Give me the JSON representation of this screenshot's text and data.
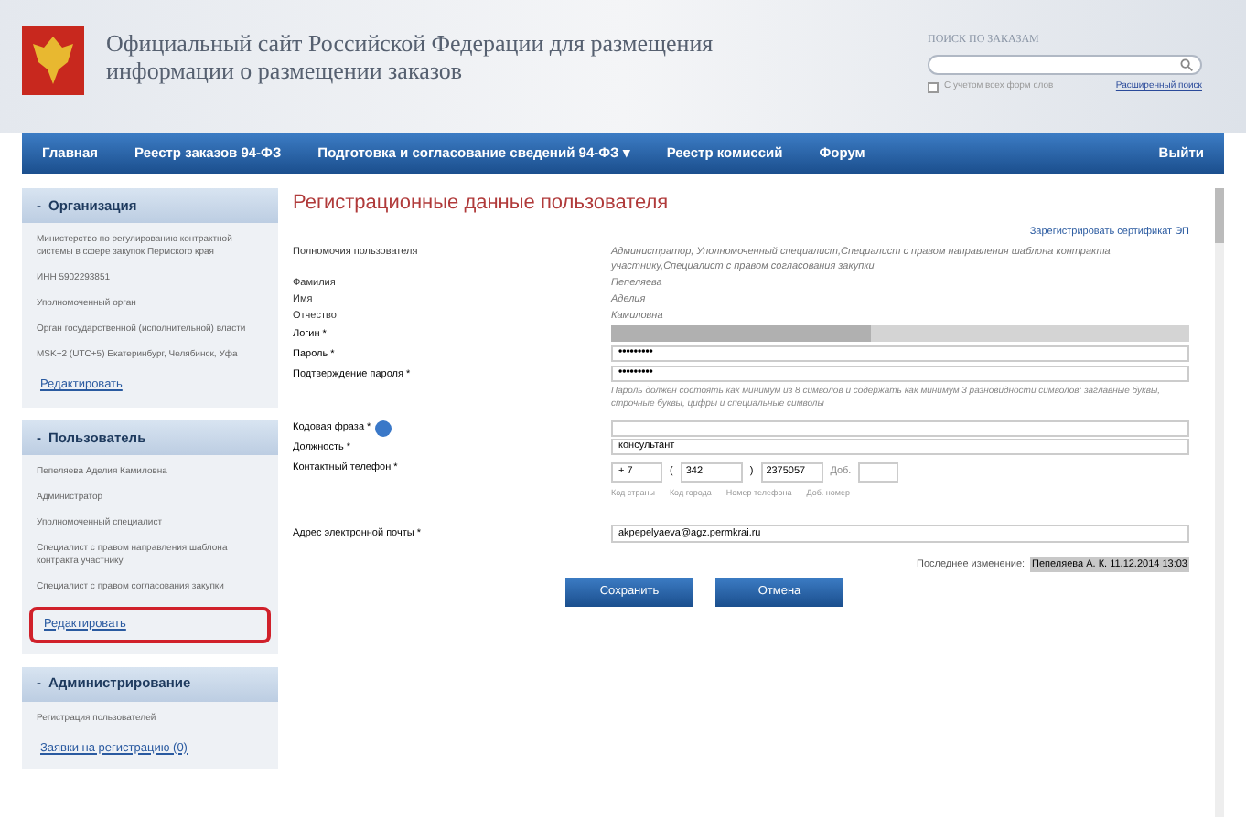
{
  "header": {
    "title_line_1": "Официальный сайт Российской Федерации для размещения",
    "title_line_2": "информации о размещении заказов",
    "search": {
      "label": "ПОИСК ПО ЗАКАЗАМ",
      "checkbox_label": "С учетом всех форм слов",
      "checked": false,
      "advanced_link": "Расширенный поиск"
    }
  },
  "nav": [
    {
      "label": "Главная"
    },
    {
      "label": "Реестр заказов 94-ФЗ"
    },
    {
      "label": "Подготовка и согласование сведений 94-ФЗ",
      "caret": "▾"
    },
    {
      "label": "Реестр комиссий"
    },
    {
      "label": "Форум"
    }
  ],
  "logout": "Выйти",
  "sidebar": [
    {
      "sign": "-",
      "title": "Организация",
      "texts": [
        "Министерство по регулированию контрактной системы в сфере закупок Пермского края",
        "ИНН 5902293851",
        "Уполномоченный орган",
        "Орган государственной (исполнительной) власти",
        "MSK+2 (UTC+5) Екатеринбург, Челябинск, Уфа"
      ],
      "link": {
        "text": "Редактировать",
        "highlighted": false
      }
    },
    {
      "sign": "-",
      "title": "Пользователь",
      "texts": [
        "Пепеляева Аделия Камиловна",
        "Администратор",
        "Уполномоченный специалист",
        "Специалист с правом направления шаблона контракта участнику",
        "Специалист с правом согласования закупки"
      ],
      "link": {
        "text": "Редактировать",
        "highlighted": true
      }
    },
    {
      "sign": "-",
      "title": "Администрирование",
      "texts": [
        "Регистрация пользователей"
      ],
      "link": {
        "text": "Заявки на регистрацию (0)",
        "highlighted": false
      }
    }
  ],
  "page_title": "Регистрационные данные пользователя",
  "cert_link": "Зарегистрировать сертификат ЭП",
  "info_rows": [
    {
      "label": "Полномочия пользователя",
      "value": "Администратор, Уполномоченный специалист,Специалист с правом направления шаблона контракта участнику,Специалист с правом согласования закупки"
    },
    {
      "label": "Фамилия",
      "value": "Пепеляева"
    },
    {
      "label": "Имя",
      "value": "Аделия"
    },
    {
      "label": "Отчество",
      "value": "Камиловна"
    }
  ],
  "login_label": "Логин *",
  "password_label": "Пароль *",
  "password_value": "•••••••••",
  "confirm_label": "Подтверждение пароля *",
  "confirm_value": "•••••••••",
  "password_hint": "Пароль должен состоять как минимум из 8 символов и содержать как минимум 3 разновидности символов: заглавные буквы, строчные буквы, цифры и специальные символы",
  "code_label": "Кодовая фраза *",
  "position_label": "Должность *",
  "position_value": "консультант",
  "phone_label": "Контактный телефон *",
  "phone": {
    "country": "+ 7",
    "open": "(",
    "city": "342",
    "close": ")",
    "number": "2375057",
    "ext_label": "Доб.",
    "captions": [
      "Код страны",
      "Код города",
      "Номер телефона",
      "Доб. номер"
    ]
  },
  "email_label": "Адрес электронной почты *",
  "email_value": "akpepelyaeva@agz.permkrai.ru",
  "last_change_label": "Последнее изменение:",
  "last_change_value": "Пепеляева А. К. 11.12.2014 13:03",
  "buttons": [
    "Сохранить",
    "Отмена"
  ]
}
